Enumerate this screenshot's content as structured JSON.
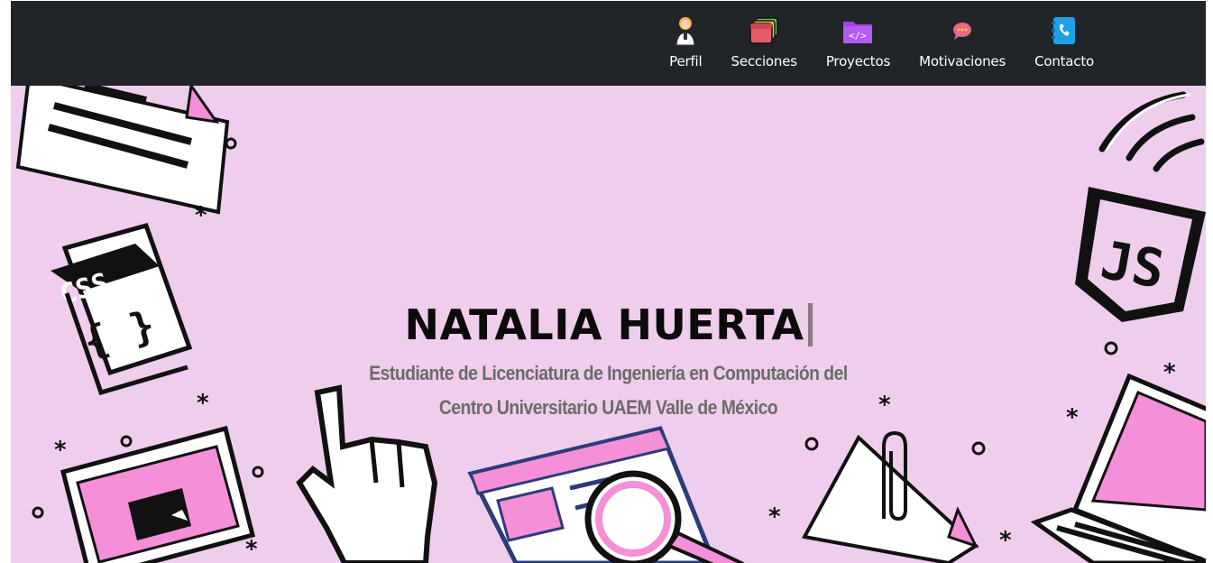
{
  "navbar": {
    "items": [
      {
        "label": "Perfil",
        "icon": "woman-profile-icon"
      },
      {
        "label": "Secciones",
        "icon": "stacked-cards-icon"
      },
      {
        "label": "Proyectos",
        "icon": "code-folder-icon"
      },
      {
        "label": "Motivaciones",
        "icon": "speech-bubble-icon"
      },
      {
        "label": "Contacto",
        "icon": "phone-contact-icon"
      }
    ]
  },
  "hero": {
    "name": "NATALIA HUERTA",
    "subtitle_line1": "Estudiante de Licenciatura de Ingeniería en Computación del",
    "subtitle_line2": "Centro Universitario UAEM Valle de México",
    "decor": {
      "css_badge": "CSS",
      "css_braces": "{ }",
      "js_badge": "JS"
    }
  },
  "colors": {
    "navbar_bg": "#212529",
    "hero_bg": "#efcdec",
    "accent_pink": "#f48fd8",
    "subtitle_gray": "#6b6b6b"
  }
}
